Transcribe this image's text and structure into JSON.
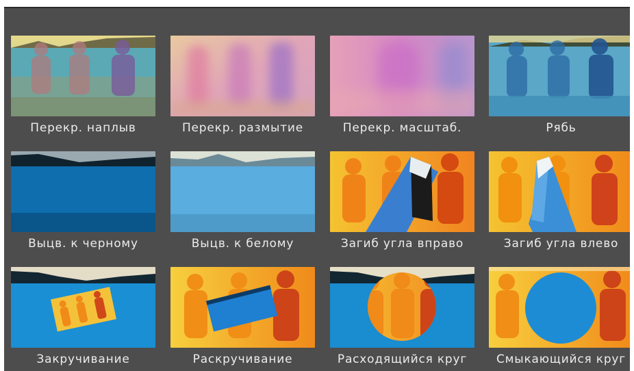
{
  "window": {
    "title": ""
  },
  "transitions": [
    {
      "label": "Перекр. наплыв",
      "icon": "cross-dissolve-icon"
    },
    {
      "label": "Перекр. размытие",
      "icon": "cross-blur-icon"
    },
    {
      "label": "Перекр. масштаб.",
      "icon": "cross-zoom-icon"
    },
    {
      "label": "Рябь",
      "icon": "ripple-icon"
    },
    {
      "label": "Выцв. к черному",
      "icon": "fade-to-black-icon"
    },
    {
      "label": "Выцв. к белому",
      "icon": "fade-to-white-icon"
    },
    {
      "label": "Загиб угла вправо",
      "icon": "page-curl-right-icon"
    },
    {
      "label": "Загиб угла влево",
      "icon": "page-curl-left-icon"
    },
    {
      "label": "Закручивание",
      "icon": "spin-in-icon"
    },
    {
      "label": "Раскручивание",
      "icon": "spin-out-icon"
    },
    {
      "label": "Расходящийся круг",
      "icon": "circle-open-icon"
    },
    {
      "label": "Смыкающийся круг",
      "icon": "circle-close-icon"
    }
  ],
  "colors": {
    "panel": "#4d4d4d",
    "label_text": "#ececec",
    "water_blue": "#1f86c8",
    "sunset_orange": "#f08a1a"
  }
}
